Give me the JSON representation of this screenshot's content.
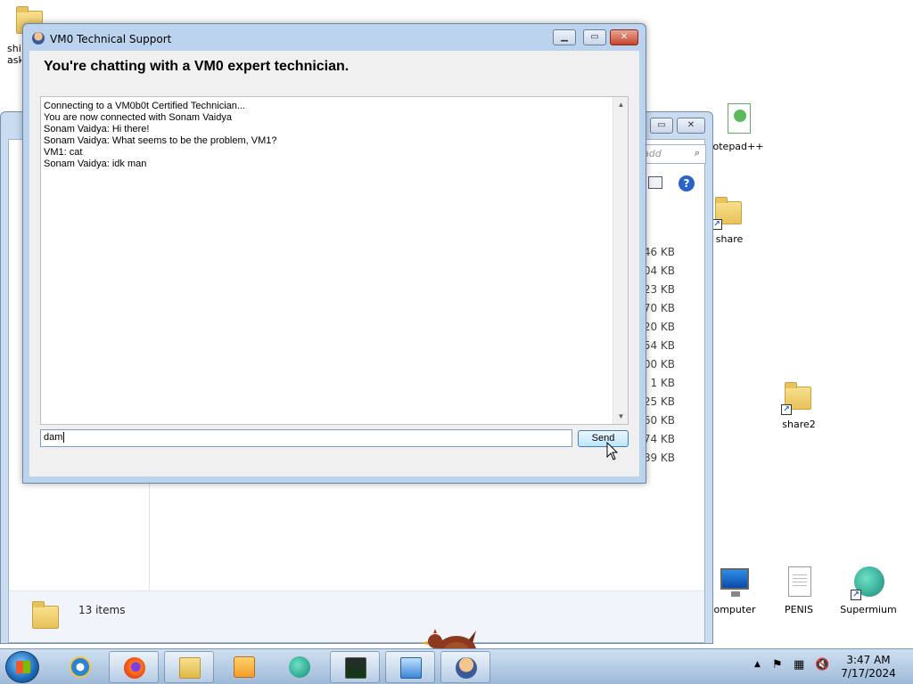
{
  "desktop": {
    "icons": [
      {
        "label": "shi ask",
        "kind": "folder"
      },
      {
        "label": "otepad++",
        "kind": "notepad"
      },
      {
        "label": "share",
        "kind": "folder"
      },
      {
        "label": "share2",
        "kind": "folder"
      },
      {
        "label": "omputer",
        "kind": "monitor"
      },
      {
        "label": "PENIS",
        "kind": "document"
      },
      {
        "label": "Supermium",
        "kind": "browser"
      }
    ]
  },
  "explorer": {
    "search_placeholder": "add",
    "status_text": "13 items",
    "sizes": [
      "46 KB",
      "04 KB",
      "23 KB",
      "70 KB",
      "20 KB",
      "54 KB",
      "00 KB",
      "1 KB",
      "25 KB",
      "60 KB",
      "74 KB",
      "89 KB"
    ]
  },
  "chat_window": {
    "title": "VM0 Technical Support",
    "header": "You're chatting with a VM0 expert technician.",
    "log_lines": [
      "Connecting to a VM0b0t Certified Technician...",
      "You are now connected with Sonam Vaidya",
      "Sonam Vaidya: Hi there!",
      "Sonam Vaidya: What seems to be the problem, VM1?",
      "VM1: cat",
      "Sonam Vaidya: idk man"
    ],
    "input_value": "dam",
    "send_label": "Send"
  },
  "taskbar": {
    "clock_time": "3:47 AM",
    "clock_date": "7/17/2024"
  }
}
